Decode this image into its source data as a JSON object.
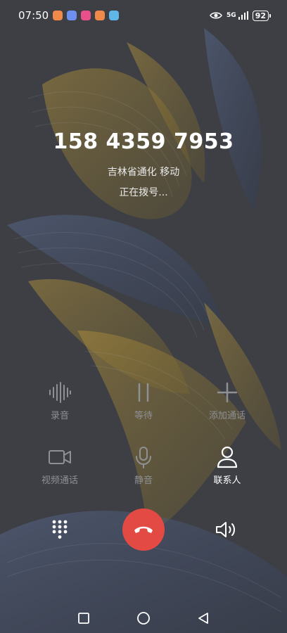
{
  "status_bar": {
    "time": "07:50",
    "app_icons": [
      "#f08a4b",
      "#6d8ff0",
      "#e8508c",
      "#f08a4b",
      "#5fb6e8"
    ],
    "network": "5G",
    "battery": "92"
  },
  "call": {
    "number": "158 4359 7953",
    "location": "吉林省通化 移动",
    "status": "正在拨号..."
  },
  "controls": {
    "record": "录音",
    "hold": "等待",
    "add_call": "添加通话",
    "video_call": "视频通话",
    "mute": "静音",
    "contacts": "联系人"
  },
  "colors": {
    "background": "#3d3f44",
    "end_call": "#e34a44",
    "disabled_text": "#8e9094"
  },
  "icons": {
    "record": "waveform-icon",
    "hold": "pause-icon",
    "add_call": "plus-icon",
    "video_call": "video-camera-icon",
    "mute": "microphone-icon",
    "contacts": "person-icon",
    "dialpad": "dialpad-icon",
    "end_call": "phone-hangup-icon",
    "speaker": "speaker-icon",
    "nav_recents": "square-icon",
    "nav_home": "circle-icon",
    "nav_back": "triangle-back-icon"
  }
}
